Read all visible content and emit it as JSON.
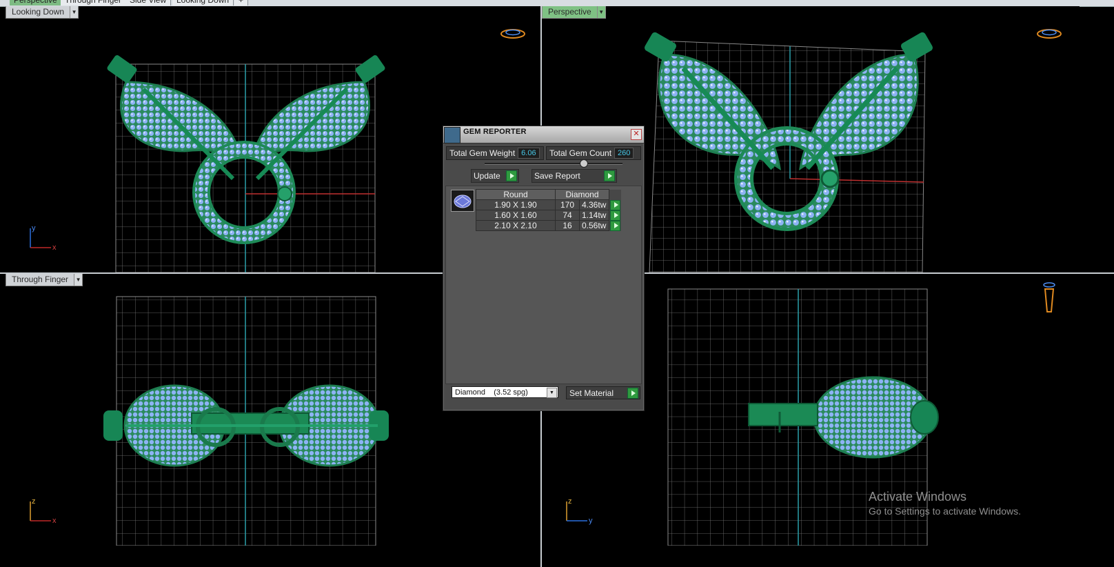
{
  "tabs": [
    {
      "label": "Perspective",
      "active": true
    },
    {
      "label": "Through Finger",
      "active": false
    },
    {
      "label": "Side View",
      "active": false
    },
    {
      "label": "Looking Down",
      "active": false
    },
    {
      "label": "+",
      "active": false
    }
  ],
  "viewports": {
    "top_left": {
      "label": "Looking Down",
      "axes": [
        "y",
        "x"
      ]
    },
    "top_right": {
      "label": "Perspective"
    },
    "bottom_left": {
      "label": "Through Finger",
      "axes": [
        "z",
        "x"
      ]
    },
    "bottom_right": {
      "label": "",
      "axes": [
        "z",
        "y"
      ]
    }
  },
  "gem_reporter": {
    "title": "GEM REPORTER",
    "total_weight_label": "Total Gem Weight",
    "total_weight_value": "6.06",
    "total_count_label": "Total Gem Count",
    "total_count_value": "260",
    "update_label": "Update",
    "save_report_label": "Save Report",
    "table_headers": [
      "Round",
      "Diamond"
    ],
    "rows": [
      {
        "size": "1.90 X 1.90",
        "count": "170",
        "weight": "4.36tw"
      },
      {
        "size": "1.60 X 1.60",
        "count": "74",
        "weight": "1.14tw"
      },
      {
        "size": "2.10 X 2.10",
        "count": "16",
        "weight": "0.56tw"
      }
    ],
    "material_select": "Diamond    (3.52 spg)",
    "set_material_label": "Set Material"
  },
  "watermark": {
    "line1": "Activate Windows",
    "line2": "Go to Settings to activate Windows."
  },
  "colors": {
    "metal": "#1f8c5a",
    "gem": "#8fb6f5",
    "grid": "#8a8a8a",
    "tab_active": "#7dbb83"
  }
}
